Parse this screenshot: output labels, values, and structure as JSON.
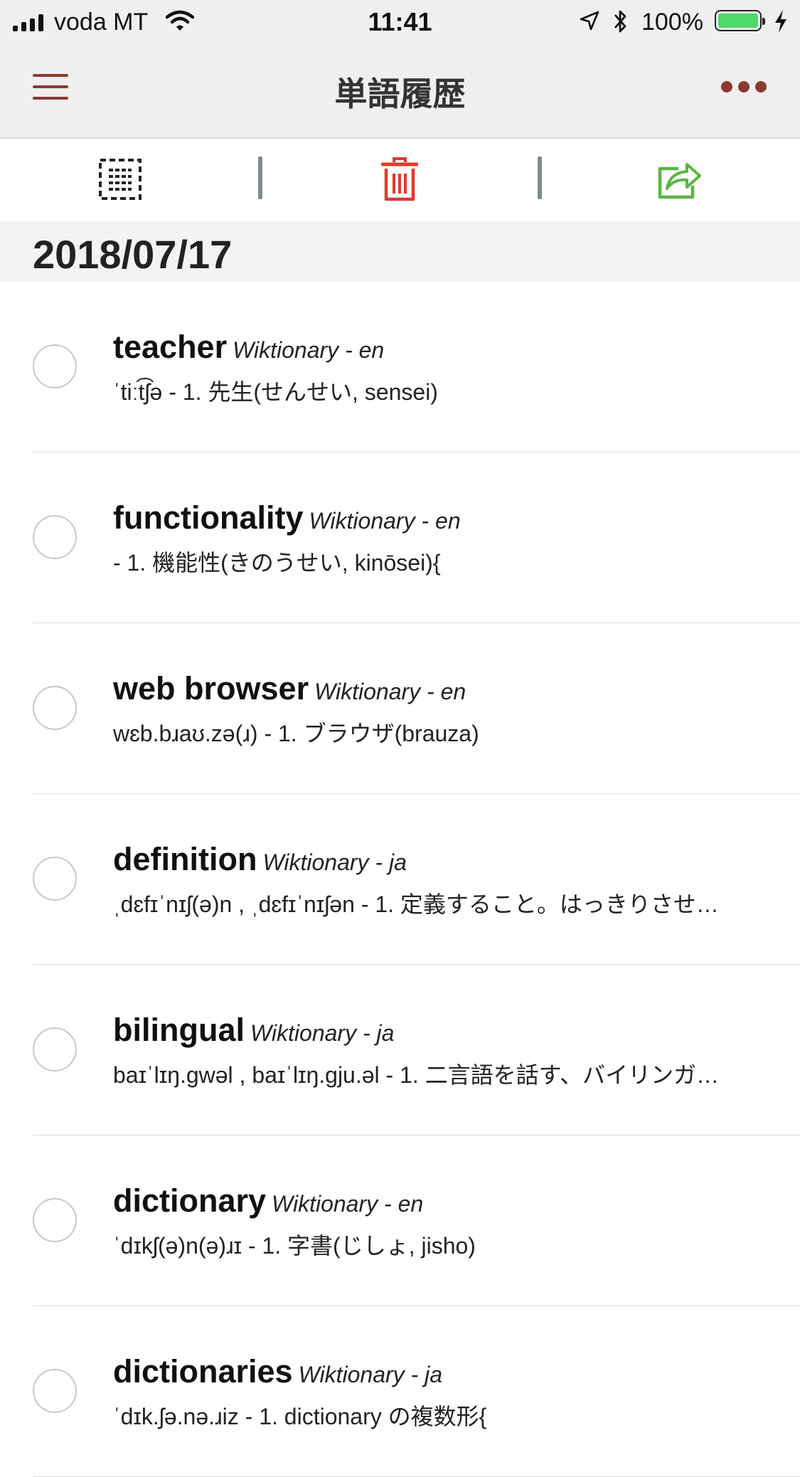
{
  "status_bar": {
    "carrier": "voda MT",
    "time": "11:41",
    "battery_percent": "100%",
    "battery_level": 1.0
  },
  "nav": {
    "title": "単語履歴"
  },
  "toolbar": {
    "select_icon": "dashed-list-icon",
    "delete_icon": "trash-icon",
    "share_icon": "share-icon",
    "colors": {
      "delete": "#e0392b",
      "share": "#5bb543",
      "select": "#222222",
      "accent": "#8b3a2e"
    }
  },
  "history": {
    "date": "2018/07/17",
    "items": [
      {
        "word": "teacher",
        "source": "Wiktionary - en",
        "definition": "ˈtiːt͡ʃə - 1. 先生(せんせい, sensei)"
      },
      {
        "word": "functionality",
        "source": "Wiktionary - en",
        "definition": " - 1. 機能性(きのうせい, kinōsei){"
      },
      {
        "word": "web browser",
        "source": "Wiktionary - en",
        "definition": "wɛb.bɹaʊ.zə(ɹ) - 1. ブラウザ(brauza)"
      },
      {
        "word": "definition",
        "source": "Wiktionary - ja",
        "definition": "ˌdɛfɪˈnɪʃ(ə)n , ˌdɛfɪˈnɪʃən - 1. 定義すること。はっきりさせ…"
      },
      {
        "word": "bilingual",
        "source": "Wiktionary - ja",
        "definition": "baɪˈlɪŋ.ɡwəl , baɪˈlɪŋ.ɡju.əl - 1. 二言語を話す、バイリンガ…"
      },
      {
        "word": "dictionary",
        "source": "Wiktionary - en",
        "definition": "ˈdɪkʃ(ə)n(ə)ɹɪ - 1. 字書(じしょ, jisho)"
      },
      {
        "word": "dictionaries",
        "source": "Wiktionary - ja",
        "definition": "ˈdɪk.ʃə.nə.ɹiz - 1. dictionary の複数形{"
      }
    ]
  }
}
